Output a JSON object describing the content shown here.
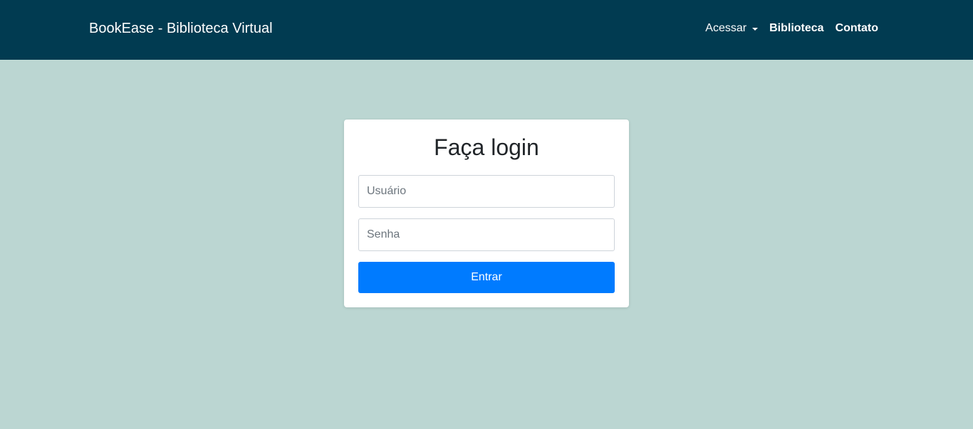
{
  "navbar": {
    "brand": "BookEase - Biblioteca Virtual",
    "items": [
      {
        "label": "Acessar",
        "has_dropdown": true
      },
      {
        "label": "Biblioteca"
      },
      {
        "label": "Contato"
      }
    ]
  },
  "login": {
    "title": "Faça login",
    "username_placeholder": "Usuário",
    "username_value": "",
    "password_placeholder": "Senha",
    "password_value": "",
    "submit_label": "Entrar"
  },
  "colors": {
    "navbar_bg": "#013b51",
    "page_bg": "#bbd6d2",
    "primary_button": "#007bff"
  },
  "icons": {
    "dropdown": "caret-down-icon"
  }
}
